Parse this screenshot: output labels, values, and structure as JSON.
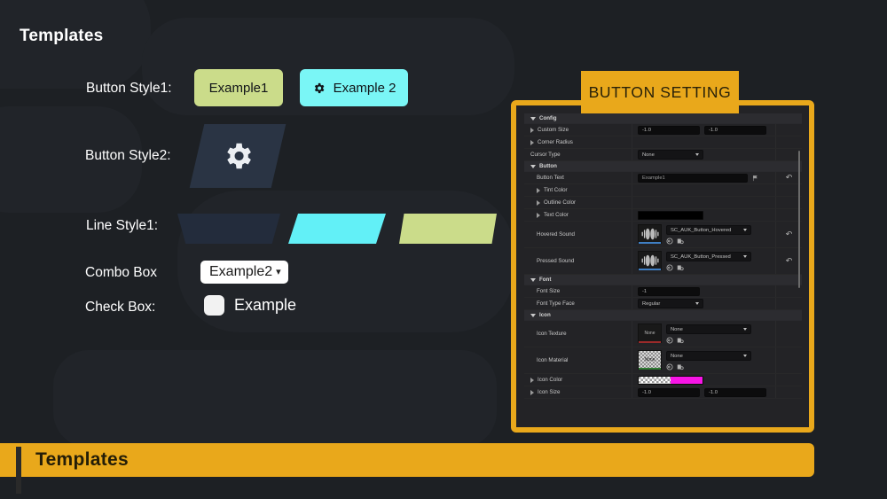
{
  "page": {
    "title": "Templates",
    "footer_title": "Templates"
  },
  "rows": {
    "button_style1_label": "Button Style1:",
    "button_style2_label": "Button Style2:",
    "line_style1_label": "Line Style1:",
    "combo_box_label": "Combo Box",
    "check_box_label": "Check Box:"
  },
  "buttons": {
    "example1": "Example1",
    "example2": "Example 2",
    "gear_icon": "gear-icon"
  },
  "combo": {
    "value": "Example2",
    "caret": "chevron-down-icon"
  },
  "checkbox": {
    "label": "Example",
    "checked": false
  },
  "colors": {
    "background": "#1d2024",
    "accent_yellow": "#e9a81b",
    "green": "#cbdc8a",
    "cyan": "#7af6f6",
    "navy": "#2a3444",
    "panel": "#232326",
    "magenta": "#f715e6"
  },
  "setting_panel": {
    "title": "BUTTON SETTING",
    "groups": [
      {
        "name": "Config",
        "expanded": true,
        "rows": [
          {
            "label": "Custom Size",
            "type": "num2",
            "arrow": "right",
            "indent": 0,
            "values": [
              "-1.0",
              "-1.0"
            ]
          },
          {
            "label": "Corner Radius",
            "type": "empty",
            "arrow": "right",
            "indent": 0,
            "values": []
          },
          {
            "label": "Cursor Type",
            "type": "dropdown",
            "arrow": "none",
            "indent": 0,
            "values": [
              "None"
            ]
          }
        ]
      },
      {
        "name": "Button",
        "expanded": true,
        "rows": [
          {
            "label": "Button Text",
            "type": "text",
            "arrow": "none",
            "indent": 1,
            "values": [
              "Example1"
            ],
            "reset": true,
            "flag": true
          },
          {
            "label": "Tint Color",
            "type": "empty",
            "arrow": "right",
            "indent": 1,
            "values": []
          },
          {
            "label": "Outline Color",
            "type": "empty",
            "arrow": "right",
            "indent": 1,
            "values": []
          },
          {
            "label": "Text Color",
            "type": "color",
            "arrow": "right",
            "indent": 1,
            "values": [
              "#000000"
            ]
          },
          {
            "label": "Hovered Sound",
            "type": "asset",
            "arrow": "none",
            "indent": 1,
            "values": [
              "SC_AUK_Button_Hovered"
            ],
            "thumb": "waveform",
            "underline": "#3f7fc4",
            "reset": true
          },
          {
            "label": "Pressed Sound",
            "type": "asset",
            "arrow": "none",
            "indent": 1,
            "values": [
              "SC_AUK_Button_Pressed"
            ],
            "thumb": "waveform",
            "underline": "#3f7fc4",
            "reset": true
          }
        ]
      },
      {
        "name": "Font",
        "expanded": true,
        "rows": [
          {
            "label": "Font Size",
            "type": "num1",
            "arrow": "none",
            "indent": 1,
            "values": [
              "-1"
            ]
          },
          {
            "label": "Font Type Face",
            "type": "dropdown",
            "arrow": "none",
            "indent": 1,
            "values": [
              "Regular"
            ]
          }
        ]
      },
      {
        "name": "Icon",
        "expanded": true,
        "rows": [
          {
            "label": "Icon Texture",
            "type": "asset",
            "arrow": "none",
            "indent": 1,
            "values": [
              "None"
            ],
            "thumb": "None",
            "underline": "#9b2a2a"
          },
          {
            "label": "Icon Material",
            "type": "asset",
            "arrow": "none",
            "indent": 1,
            "values": [
              "None"
            ],
            "thumb": "None",
            "underline": "#2f7a32",
            "checker": true
          },
          {
            "label": "Icon Color",
            "type": "colormagenta",
            "arrow": "right",
            "indent": 0,
            "values": [
              "#f715e6"
            ]
          },
          {
            "label": "Icon Size",
            "type": "num2",
            "arrow": "right",
            "indent": 0,
            "values": [
              "-1.0",
              "-1.0"
            ]
          }
        ]
      }
    ],
    "icon_names": {
      "browse": "browse-icon",
      "use_selected": "use-selected-asset-icon",
      "flag": "flag-icon",
      "revert": "revert-arrow-icon",
      "waveform": "sound-waveform-icon"
    }
  }
}
